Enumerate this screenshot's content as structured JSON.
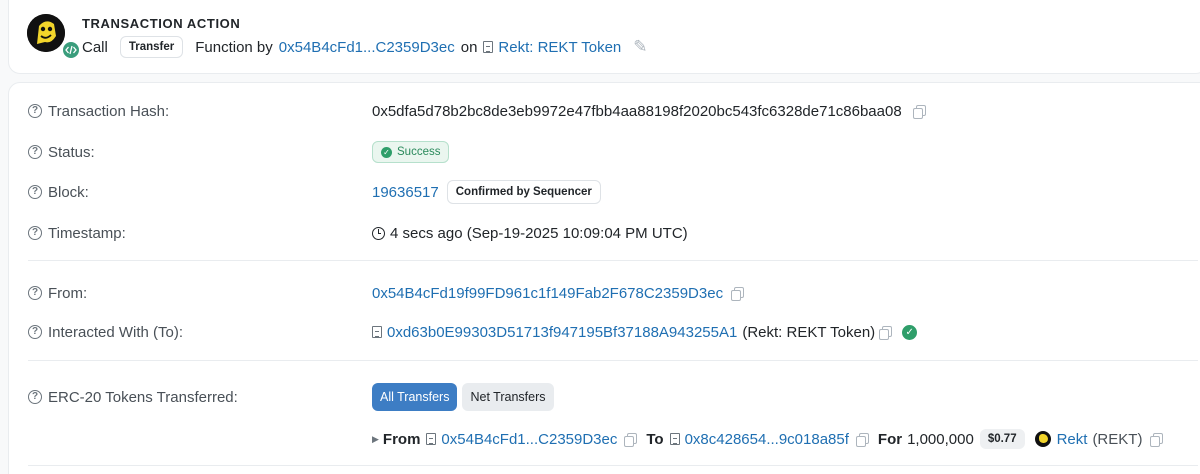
{
  "action": {
    "title": "TRANSACTION ACTION",
    "call": "Call",
    "method": "Transfer",
    "function_by": "Function by",
    "from_short": "0x54B4cFd1...C2359D3ec",
    "on": "on",
    "token_name": "Rekt: REKT Token"
  },
  "details": {
    "tx_hash_label": "Transaction Hash:",
    "tx_hash": "0x5dfa5d78b2bc8de3eb9972e47fbb4aa88198f2020bc543fc6328de71c86baa08",
    "status_label": "Status:",
    "status": "Success",
    "block_label": "Block:",
    "block": "19636517",
    "confirmation": "Confirmed by Sequencer",
    "timestamp_label": "Timestamp:",
    "timestamp": "4 secs ago (Sep-19-2025 10:09:04 PM UTC)",
    "from_label": "From:",
    "from": "0x54B4cFd19f99FD961c1f149Fab2F678C2359D3ec",
    "to_label": "Interacted With (To):",
    "to": "0xd63b0E99303D51713f947195Bf37188A943255A1",
    "to_name": "(Rekt: REKT Token)",
    "erc20_label": "ERC-20 Tokens Transferred:",
    "tab_all": "All Transfers",
    "tab_net": "Net Transfers"
  },
  "transfer": {
    "from_word": "From",
    "from": "0x54B4cFd1...C2359D3ec",
    "to_word": "To",
    "to": "0x8c428654...9c018a85f",
    "for_word": "For",
    "amount": "1,000,000",
    "price": "$0.77",
    "token": "Rekt",
    "symbol": "(REKT)"
  },
  "colors": {
    "link": "#1f6fb2",
    "success": "#2f9e6a",
    "primary_button": "#3d7dc4"
  }
}
